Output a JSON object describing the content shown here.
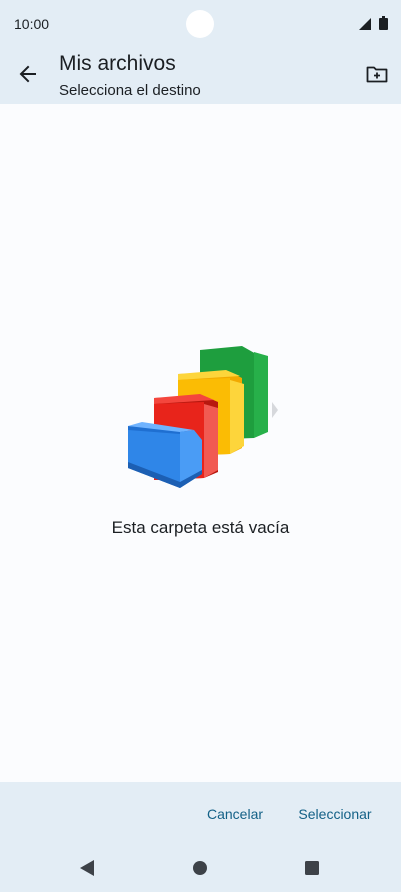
{
  "status_bar": {
    "time": "10:00",
    "icons": [
      "signal-icon",
      "battery-icon"
    ]
  },
  "app_bar": {
    "back_icon": "arrow-left-icon",
    "title": "Mis archivos",
    "subtitle": "Selecciona el destino",
    "action_icon": "new-folder-icon"
  },
  "content": {
    "illustration": "empty-folders-illustration",
    "empty_message": "Esta carpeta está vacía"
  },
  "actions": {
    "cancel_label": "Cancelar",
    "select_label": "Seleccionar"
  },
  "nav_bar": {
    "icons": [
      "nav-back-icon",
      "nav-home-icon",
      "nav-recents-icon"
    ]
  },
  "colors": {
    "bar_background": "#e3edf5",
    "content_background": "#fbfcfe",
    "accent": "#136187",
    "folder_green": "#1e9e3e",
    "folder_yellow": "#fbbc04",
    "folder_red": "#e8241b",
    "folder_blue": "#2f86e8"
  }
}
